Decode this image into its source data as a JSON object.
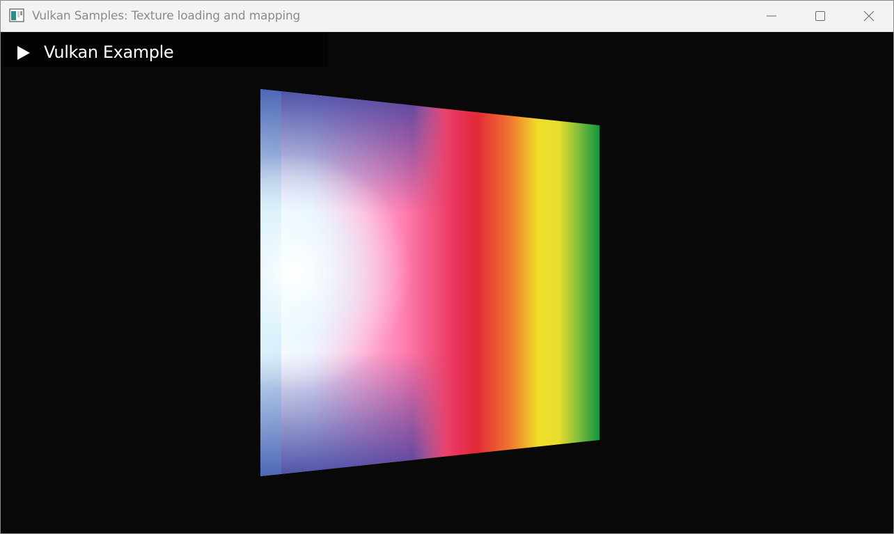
{
  "window": {
    "title": "Vulkan Samples: Texture loading and mapping"
  },
  "titlebar_buttons": {
    "minimize_icon": "minimize-icon",
    "maximize_icon": "maximize-icon",
    "close_icon": "close-icon"
  },
  "overlay": {
    "title": "Vulkan Example",
    "toggle_icon": "triangle-right-icon"
  },
  "texture": {
    "colors": [
      "#ffffff",
      "#e6e4ff",
      "#ff8fc0",
      "#e8335a",
      "#e32a35",
      "#f07a30",
      "#f0de2a",
      "#a3c93a",
      "#10953f"
    ]
  }
}
